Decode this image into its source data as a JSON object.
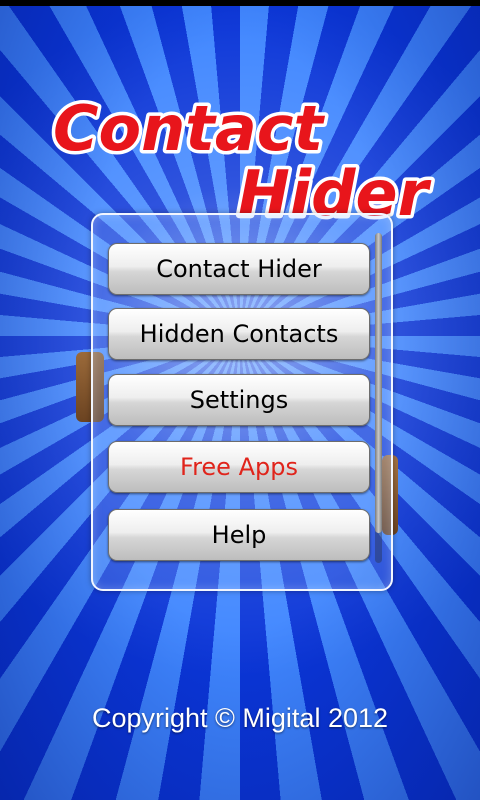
{
  "app": {
    "title_line1": "Contact",
    "title_line2": "Hider"
  },
  "menu": {
    "items": [
      {
        "label": "Contact Hider"
      },
      {
        "label": "Hidden Contacts"
      },
      {
        "label": "Settings"
      },
      {
        "label": "Free Apps"
      },
      {
        "label": "Help"
      }
    ]
  },
  "footer": {
    "copyright": "Copyright © Migital 2012"
  },
  "colors": {
    "title_red": "#e8151b",
    "free_apps_red": "#e0241b",
    "background_blue": "#1a4fe6"
  }
}
